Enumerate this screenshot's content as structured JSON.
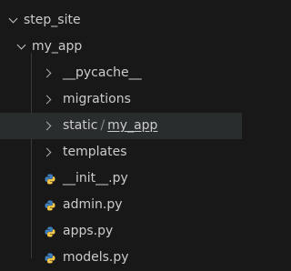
{
  "explorer": {
    "root": {
      "label": "step_site"
    },
    "app": {
      "label": "my_app"
    },
    "folders": [
      {
        "label": "__pycache__"
      },
      {
        "label": "migrations"
      },
      {
        "prefix": "static",
        "separator": "/",
        "compact": "my_app"
      },
      {
        "label": "templates"
      }
    ],
    "files": [
      {
        "label": "__init__.py",
        "icon": "python-icon"
      },
      {
        "label": "admin.py",
        "icon": "python-icon"
      },
      {
        "label": "apps.py",
        "icon": "python-icon"
      },
      {
        "label": "models.py",
        "icon": "python-icon"
      }
    ]
  },
  "colors": {
    "background": "#181818",
    "text": "#cccccc",
    "selected_row": "#2a2d2e",
    "python_blue": "#3f7fbf",
    "python_yellow": "#f5c84a"
  }
}
